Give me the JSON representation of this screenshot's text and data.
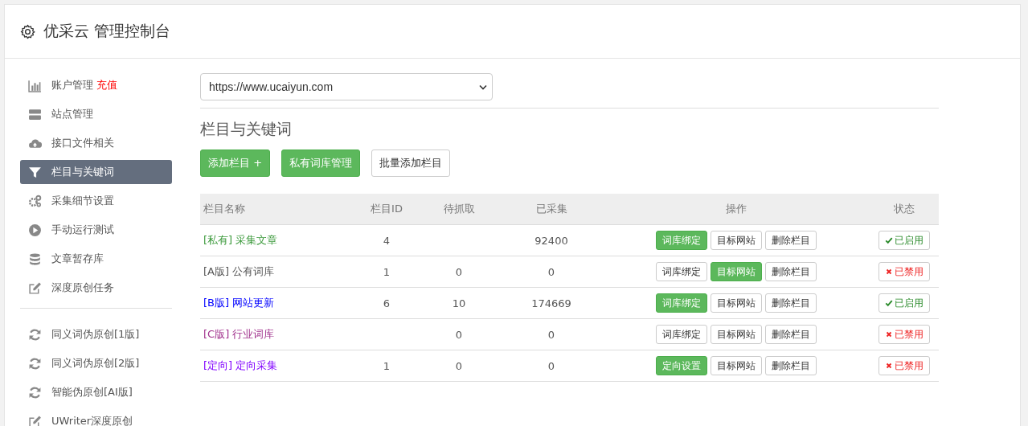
{
  "header": {
    "title": "优采云 管理控制台"
  },
  "sidebar": {
    "items": [
      {
        "label": "账户管理",
        "badge": "充值",
        "selected": false
      },
      {
        "label": "站点管理",
        "selected": false
      },
      {
        "label": "接口文件相关",
        "selected": false
      },
      {
        "label": "栏目与关键词",
        "selected": true
      },
      {
        "label": "采集细节设置",
        "selected": false
      },
      {
        "label": "手动运行测试",
        "selected": false
      },
      {
        "label": "文章暂存库",
        "selected": false
      },
      {
        "label": "深度原创任务",
        "selected": false
      }
    ],
    "tools": [
      {
        "label": "同义词伪原创[1版]"
      },
      {
        "label": "同义词伪原创[2版]"
      },
      {
        "label": "智能伪原创[AI版]"
      },
      {
        "label": "UWriter深度原创"
      }
    ]
  },
  "site_select": {
    "value": "https://www.ucaiyun.com"
  },
  "section": {
    "title": "栏目与关键词",
    "buttons": [
      {
        "label": "添加栏目 +",
        "primary": true
      },
      {
        "label": "私有词库管理",
        "primary": true
      },
      {
        "label": "批量添加栏目",
        "primary": false
      }
    ]
  },
  "table": {
    "columns": [
      "栏目名称",
      "栏目ID",
      "待抓取",
      "已采集",
      "操作",
      "状态"
    ],
    "rows": [
      {
        "name": "[私有] 采集文章",
        "color": "#3c9a3c",
        "id": "4",
        "pending": null,
        "collected": "92400",
        "actions": [
          {
            "label": "词库绑定",
            "primary": true
          },
          {
            "label": "目标网站",
            "primary": false
          },
          {
            "label": "删除栏目",
            "primary": false
          }
        ],
        "status": {
          "label": "已启用",
          "enabled": true
        }
      },
      {
        "name": "[A版] 公有词库",
        "color": "#555555",
        "id": "1",
        "pending": "0",
        "collected": "0",
        "actions": [
          {
            "label": "词库绑定",
            "primary": false
          },
          {
            "label": "目标网站",
            "primary": true
          },
          {
            "label": "删除栏目",
            "primary": false
          }
        ],
        "status": {
          "label": "已禁用",
          "enabled": false
        }
      },
      {
        "name": "[B版] 网站更新",
        "color": "#0000ff",
        "id": "6",
        "pending": "10",
        "collected": "174669",
        "actions": [
          {
            "label": "词库绑定",
            "primary": true
          },
          {
            "label": "目标网站",
            "primary": false
          },
          {
            "label": "删除栏目",
            "primary": false
          }
        ],
        "status": {
          "label": "已启用",
          "enabled": true
        }
      },
      {
        "name": "[C版] 行业词库",
        "color": "#a0308c",
        "id": null,
        "pending": "0",
        "collected": "0",
        "actions": [
          {
            "label": "词库绑定",
            "primary": false
          },
          {
            "label": "目标网站",
            "primary": false
          },
          {
            "label": "删除栏目",
            "primary": false
          }
        ],
        "status": {
          "label": "已禁用",
          "enabled": false
        }
      },
      {
        "name": "[定向] 定向采集",
        "color": "#8000ff",
        "id": "1",
        "pending": "0",
        "collected": "0",
        "actions": [
          {
            "label": "定向设置",
            "primary": true
          },
          {
            "label": "目标网站",
            "primary": false
          },
          {
            "label": "删除栏目",
            "primary": false
          }
        ],
        "status": {
          "label": "已禁用",
          "enabled": false
        }
      }
    ]
  }
}
